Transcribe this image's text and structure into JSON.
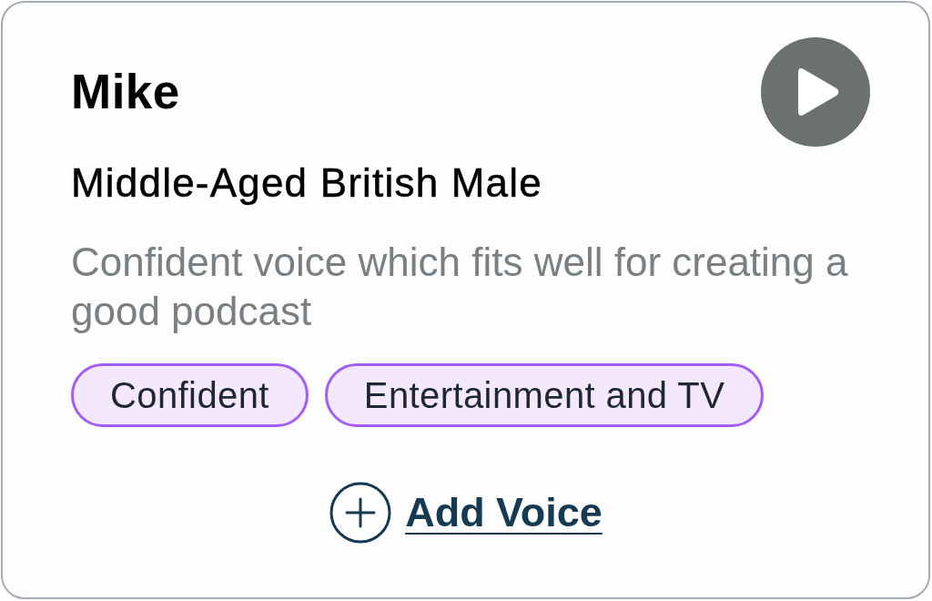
{
  "voice_card": {
    "name": "Mike",
    "subtitle": "Middle-Aged British Male",
    "description": "Confident voice which fits well for creating a good podcast",
    "tags": [
      "Confident",
      "Entertainment and TV"
    ],
    "add_button": {
      "label": "Add Voice"
    }
  }
}
